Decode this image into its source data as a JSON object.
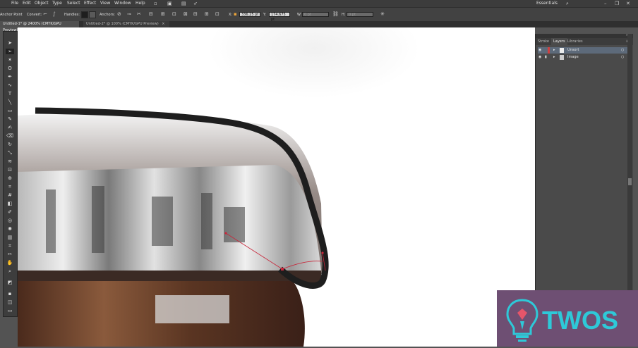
{
  "menu": [
    "File",
    "Edit",
    "Object",
    "Type",
    "Select",
    "Effect",
    "View",
    "Window",
    "Help"
  ],
  "workspace": "Essentials",
  "control": {
    "anchor_point_label": "Anchor Point",
    "convert_label": "Convert:",
    "handles_label": "Handles:",
    "anchors_label": "Anchors:",
    "x_label": "X:",
    "x_value": "336.25 pt",
    "y_label": "Y:",
    "y_value": "174.675 pt",
    "w_label": "W:",
    "w_value": "0 pt",
    "h_label": "H:",
    "h_value": "0 pt"
  },
  "tabs": [
    {
      "label": "Untitled-1* @ 2400% (CMYK/GPU Preview)",
      "active": true
    },
    {
      "label": "Untitled-2* @ 100% (CMYK/GPU Preview)",
      "active": false
    }
  ],
  "panel": {
    "tabs": [
      "Stroke",
      "Layers",
      "Libraries"
    ],
    "active_tab": "Layers",
    "layers": [
      {
        "name": "Unsort",
        "selected": true
      },
      {
        "name": "Image",
        "selected": false
      }
    ]
  },
  "brand": {
    "text": "TWOS",
    "color": "#2ec9d8",
    "bg": "#6e4f73"
  },
  "colors": {
    "path": "#1e1e1e",
    "handle": "#c8283c"
  }
}
